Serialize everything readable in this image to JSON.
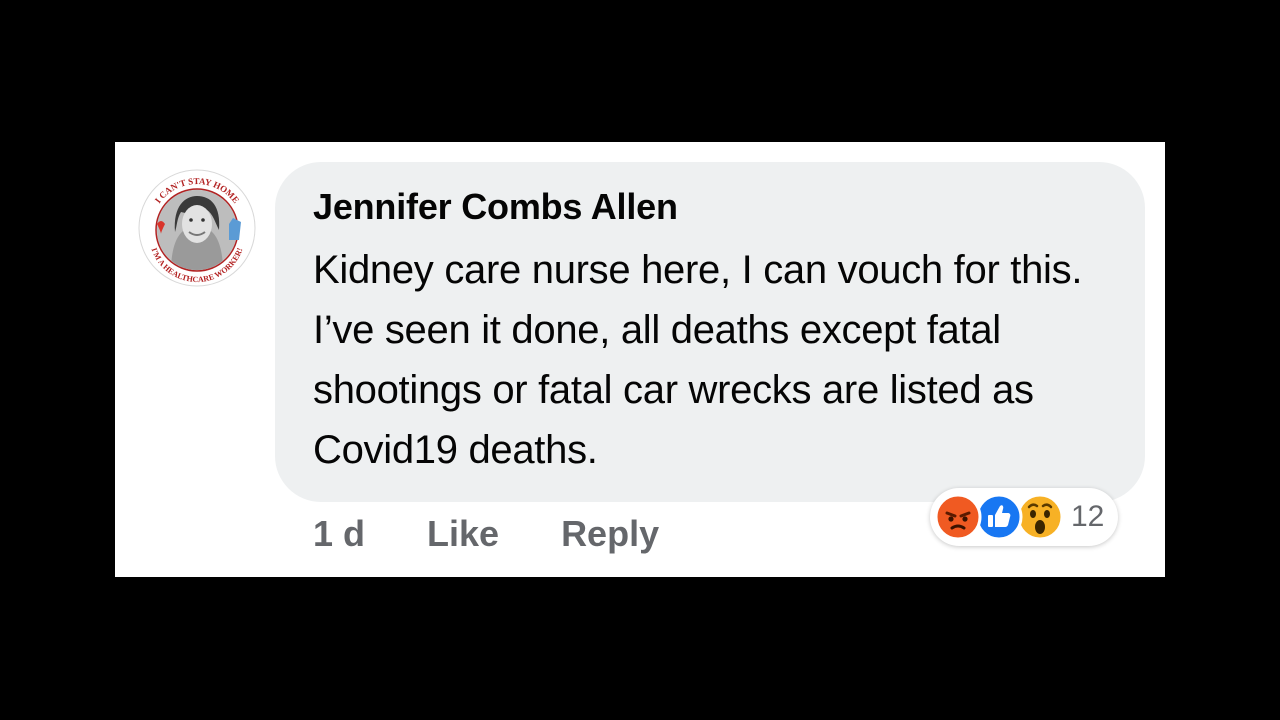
{
  "comment": {
    "author": "Jennifer Combs Allen",
    "text": "Kidney care nurse here, I can vouch for this. I’ve seen it done, all deaths except fatal shootings or fatal car wrecks are listed as Covid19 deaths.",
    "timestamp": "1 d",
    "like_label": "Like",
    "reply_label": "Reply",
    "avatar_frame_text_top": "I CAN'T STAY HOME",
    "avatar_frame_text_bottom": "I'M A HEALTHCARE WORKER!"
  },
  "reactions": {
    "icons": [
      "angry-icon",
      "like-icon",
      "wow-icon"
    ],
    "count": "12"
  },
  "colors": {
    "background": "#000000",
    "panel": "#ffffff",
    "bubble": "#eef0f1",
    "text": "#050505",
    "secondary_text": "#65676b",
    "like_blue": "#1877f2",
    "angry_orange": "#f05a22",
    "wow_yellow": "#f7b125"
  }
}
